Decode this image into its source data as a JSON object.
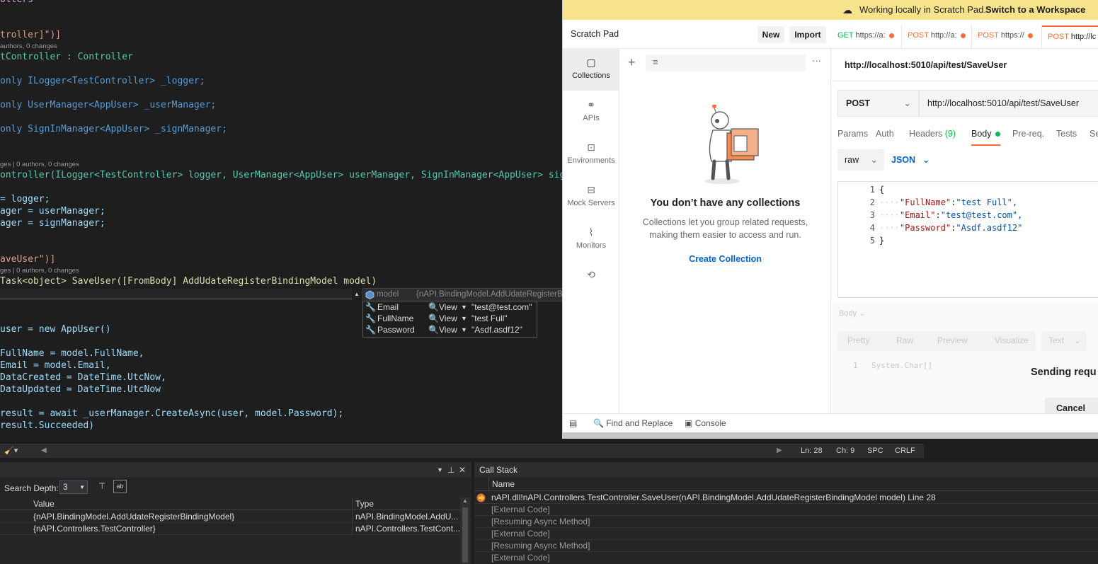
{
  "editor": {
    "lines": [
      {
        "t": "otters"
      },
      {
        "t": "troller]\")]"
      },
      {
        "t": "authors, 0 changes"
      },
      {
        "t": "tController : Controller"
      },
      {
        "t": "only ILogger<TestController> _logger;"
      },
      {
        "t": "only UserManager<AppUser> _userManager;"
      },
      {
        "t": "only SignInManager<AppUser> _signManager;"
      },
      {
        "t": "ges | 0 authors, 0 changes"
      },
      {
        "t": "ontroller(ILogger<TestController> logger, UserManager<AppUser> userManager, SignInManager<AppUser> signMa"
      },
      {
        "t": "= logger;"
      },
      {
        "t": "ager = userManager;"
      },
      {
        "t": "ager = signManager;"
      },
      {
        "t": "aveUser\")]"
      },
      {
        "t": "ges | 0 authors, 0 changes"
      },
      {
        "t": "Task<object> SaveUser([FromBody] AddUdateRegisterBindingModel model)"
      },
      {
        "t": "user = new AppUser()"
      },
      {
        "t": "FullName = model.FullName,"
      },
      {
        "t": "Email = model.Email,"
      },
      {
        "t": "DataCreated = DateTime.UtcNow,"
      },
      {
        "t": "DataUpdated = DateTime.UtcNow"
      },
      {
        "t": "result = await _userManager.CreateAsync(user, model.Password);"
      },
      {
        "t": "result.Succeeded)"
      }
    ]
  },
  "datatip": {
    "name": "model",
    "value": "{nAPI.BindingModel.AddUdateRegisterBindingModel}",
    "rows": [
      {
        "name": "Email",
        "view": "View",
        "value": "\"test@test.com\""
      },
      {
        "name": "FullName",
        "view": "View",
        "value": "\"test Full\""
      },
      {
        "name": "Password",
        "view": "View",
        "value": "\"Asdf.asdf12\""
      }
    ]
  },
  "status": {
    "ln": "Ln: 28",
    "ch": "Ch: 9",
    "spc": "SPC",
    "crlf": "CRLF"
  },
  "locals": {
    "search_depth_label": "Search Depth:",
    "search_depth_value": "3",
    "col_value": "Value",
    "col_type": "Type",
    "rows": [
      {
        "value": "{nAPI.BindingModel.AddUdateRegisterBindingModel}",
        "type": "nAPI.BindingModel.AddU..."
      },
      {
        "value": "{nAPI.Controllers.TestController}",
        "type": "nAPI.Controllers.TestCont..."
      }
    ]
  },
  "callstack": {
    "title": "Call Stack",
    "col_name": "Name",
    "rows": [
      "nAPI.dll!nAPI.Controllers.TestController.SaveUser(nAPI.BindingModel.AddUdateRegisterBindingModel model) Line 28",
      "[External Code]",
      "[Resuming Async Method]",
      "[External Code]",
      "[Resuming Async Method]",
      "[External Code]"
    ]
  },
  "postman": {
    "banner_text": "Working locally in Scratch Pad.",
    "banner_link": "Switch to a Workspace",
    "title": "Scratch Pad",
    "new_btn": "New",
    "import_btn": "Import",
    "tabs": [
      {
        "method": "GET",
        "url": "https://a:"
      },
      {
        "method": "POST",
        "url": "http://a:"
      },
      {
        "method": "POST",
        "url": "https://"
      },
      {
        "method": "POST",
        "url": "http://lc"
      }
    ],
    "rail": [
      "Collections",
      "APIs",
      "Environments",
      "Mock Servers",
      "Monitors"
    ],
    "empty_title": "You don’t have any collections",
    "empty_desc_1": "Collections let you group related requests,",
    "empty_desc_2": "making them easier to access and run.",
    "create_collection": "Create Collection",
    "request_title": "http://localhost:5010/api/test/SaveUser",
    "method": "POST",
    "url": "http://localhost:5010/api/test/SaveUser",
    "param_tabs": {
      "params": "Params",
      "auth": "Auth",
      "headers": "Headers",
      "headers_count": "(9)",
      "body": "Body",
      "prereq": "Pre-req.",
      "tests": "Tests",
      "settings": "Se"
    },
    "body_mode": "raw",
    "body_lang": "JSON",
    "json_lines": [
      {
        "n": "1",
        "t": "{"
      },
      {
        "n": "2",
        "k": "\"FullName\"",
        "v": "\"test Full\","
      },
      {
        "n": "3",
        "k": "\"Email\"",
        "v": "\"test@test.com\","
      },
      {
        "n": "4",
        "k": "\"Password\"",
        "v": "\"Asdf.asdf12\""
      },
      {
        "n": "5",
        "t": "}"
      }
    ],
    "resp_label": "Body",
    "resp_tabs": [
      "Pretty",
      "Raw",
      "Preview",
      "Visualize"
    ],
    "resp_format": "Text",
    "resp_line_no": "1",
    "resp_line": "System.Char[]",
    "sending": "Sending requ",
    "cancel": "Cancel",
    "footer": {
      "find": "Find and Replace",
      "console": "Console"
    }
  },
  "colors": {
    "accent": "#ff6c37",
    "link": "#0265d2",
    "banner": "#f7e38c"
  }
}
